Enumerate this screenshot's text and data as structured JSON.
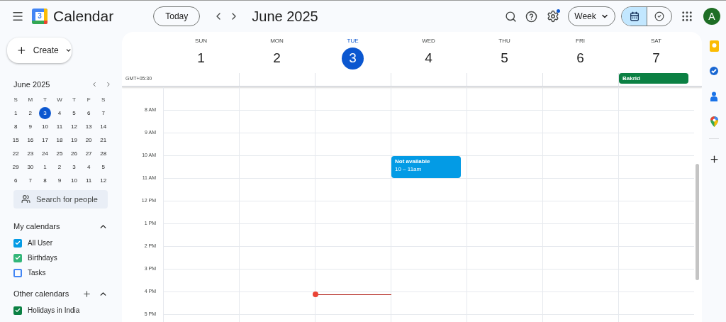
{
  "topbar": {
    "logo_text": "3",
    "app_title": "Calendar",
    "today_button": "Today",
    "month_title": "June 2025",
    "settings_notification": true,
    "view_select": "Week",
    "view_toggle": [
      {
        "kind": "calendar",
        "selected": true
      },
      {
        "kind": "tasks",
        "selected": false
      }
    ],
    "avatar": "A"
  },
  "sidebar": {
    "create_button": "Create",
    "mini_calendar": {
      "title": "June 2025",
      "weekdays": [
        "S",
        "M",
        "T",
        "W",
        "T",
        "F",
        "S"
      ],
      "weeks": [
        [
          {
            "label": "1",
            "selected": false
          },
          {
            "label": "2",
            "selected": false
          },
          {
            "label": "3",
            "selected": true
          },
          {
            "label": "4",
            "selected": false
          },
          {
            "label": "5",
            "selected": false
          },
          {
            "label": "6",
            "selected": false
          },
          {
            "label": "7",
            "selected": false
          }
        ],
        [
          {
            "label": "8",
            "selected": false
          },
          {
            "label": "9",
            "selected": false
          },
          {
            "label": "10",
            "selected": false
          },
          {
            "label": "11",
            "selected": false
          },
          {
            "label": "12",
            "selected": false
          },
          {
            "label": "13",
            "selected": false
          },
          {
            "label": "14",
            "selected": false
          }
        ],
        [
          {
            "label": "15",
            "selected": false
          },
          {
            "label": "16",
            "selected": false
          },
          {
            "label": "17",
            "selected": false
          },
          {
            "label": "18",
            "selected": false
          },
          {
            "label": "19",
            "selected": false
          },
          {
            "label": "20",
            "selected": false
          },
          {
            "label": "21",
            "selected": false
          }
        ],
        [
          {
            "label": "22",
            "selected": false
          },
          {
            "label": "23",
            "selected": false
          },
          {
            "label": "24",
            "selected": false
          },
          {
            "label": "25",
            "selected": false
          },
          {
            "label": "26",
            "selected": false
          },
          {
            "label": "27",
            "selected": false
          },
          {
            "label": "28",
            "selected": false
          }
        ],
        [
          {
            "label": "29",
            "selected": false
          },
          {
            "label": "30",
            "selected": false
          },
          {
            "label": "1",
            "selected": false
          },
          {
            "label": "2",
            "selected": false
          },
          {
            "label": "3",
            "selected": false
          },
          {
            "label": "4",
            "selected": false
          },
          {
            "label": "5",
            "selected": false
          }
        ],
        [
          {
            "label": "6",
            "selected": false
          },
          {
            "label": "7",
            "selected": false
          },
          {
            "label": "8",
            "selected": false
          },
          {
            "label": "9",
            "selected": false
          },
          {
            "label": "10",
            "selected": false
          },
          {
            "label": "11",
            "selected": false
          },
          {
            "label": "12",
            "selected": false
          }
        ]
      ]
    },
    "search_people": {
      "placeholder": "Search for people"
    },
    "sections": [
      {
        "title": "My calendars",
        "expanded": true,
        "can_add": false,
        "items": [
          {
            "label": "All User",
            "checked": true,
            "color": "#039be5"
          },
          {
            "label": "Birthdays",
            "checked": true,
            "color": "#33b679"
          },
          {
            "label": "Tasks",
            "checked": false,
            "color": "#4285f4"
          }
        ]
      },
      {
        "title": "Other calendars",
        "expanded": true,
        "can_add": true,
        "items": [
          {
            "label": "Holidays in India",
            "checked": true,
            "color": "#0b8043"
          }
        ]
      }
    ]
  },
  "week": {
    "timezone": "GMT+05:30",
    "days": [
      {
        "name": "SUN",
        "number": "1",
        "selected": false
      },
      {
        "name": "MON",
        "number": "2",
        "selected": false
      },
      {
        "name": "TUE",
        "number": "3",
        "selected": true
      },
      {
        "name": "WED",
        "number": "4",
        "selected": false
      },
      {
        "name": "THU",
        "number": "5",
        "selected": false
      },
      {
        "name": "FRI",
        "number": "6",
        "selected": false
      },
      {
        "name": "SAT",
        "number": "7",
        "selected": false,
        "all_day": [
          {
            "title": "Bakrid",
            "color": "#0b8043"
          }
        ]
      }
    ],
    "rows": [
      {},
      {
        "label": "8 AM"
      },
      {
        "label": "9 AM"
      },
      {
        "label": "10 AM",
        "cells": [
          {},
          {},
          {},
          {
            "event": {
              "title": "Not available",
              "time": "10 – 11am",
              "color": "#039be5"
            }
          },
          {},
          {},
          {}
        ]
      },
      {
        "label": "11 AM"
      },
      {
        "label": "12 PM"
      },
      {
        "label": "1 PM"
      },
      {
        "label": "2 PM"
      },
      {
        "label": "3 PM"
      },
      {
        "label": "4 PM",
        "cells": [
          {},
          {},
          {
            "now_line": true
          },
          {},
          {},
          {},
          {}
        ]
      },
      {
        "label": "5 PM"
      }
    ]
  }
}
